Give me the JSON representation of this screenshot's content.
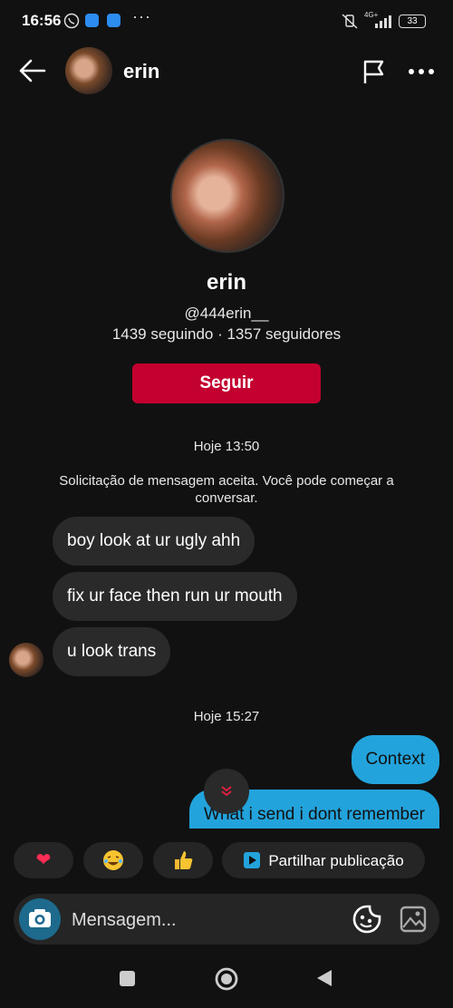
{
  "status_bar": {
    "time": "16:56",
    "network": "4G+",
    "battery": "33"
  },
  "header": {
    "name": "erin"
  },
  "profile": {
    "name": "erin",
    "handle": "@444erin__",
    "stats": "1439 seguindo · 1357 seguidores",
    "follow_label": "Seguir"
  },
  "chat": {
    "stamp1": "Hoje 13:50",
    "system_message": "Solicitação de mensagem aceita. Você pode começar a conversar.",
    "incoming": [
      "boy look at ur ugly ahh",
      "fix ur face then run ur mouth",
      "u look trans"
    ],
    "stamp2": "Hoje 15:27",
    "outgoing": [
      "Context",
      "What i send i dont remember"
    ]
  },
  "quick_actions": {
    "share_label": "Partilhar publicação"
  },
  "composer": {
    "placeholder": "Mensagem..."
  },
  "colors": {
    "follow": "#c3002f",
    "outgoing_bubble": "#23a3dc",
    "incoming_bubble": "#2a2a2a"
  }
}
